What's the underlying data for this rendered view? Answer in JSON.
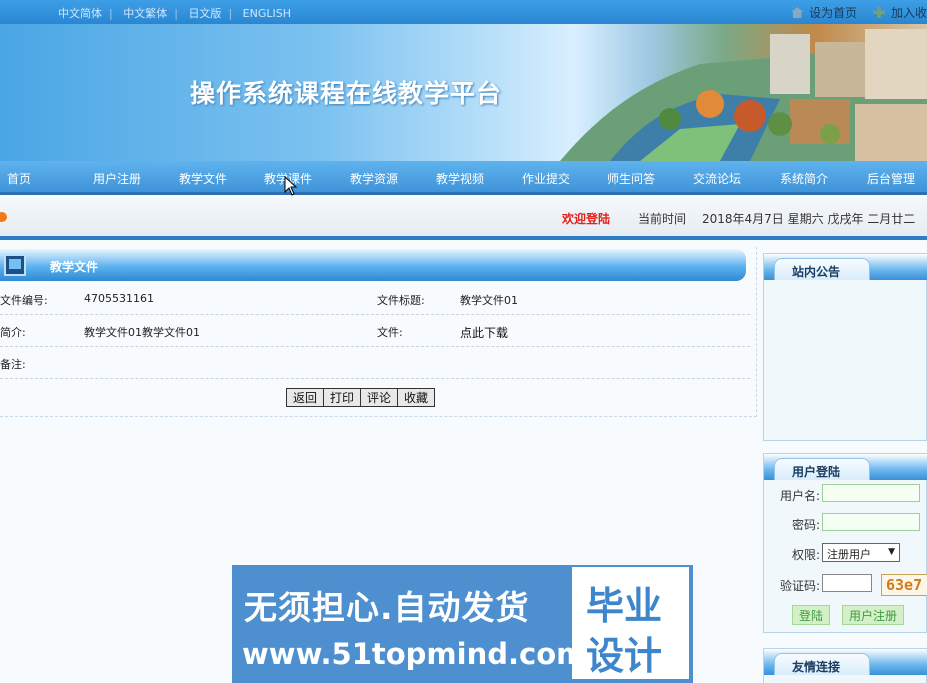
{
  "topbar": {
    "languages": [
      "中文简体",
      "中文繁体",
      "日文版",
      "ENGLISH"
    ],
    "set_home": "设为首页",
    "add_favorite": "加入收"
  },
  "banner": {
    "title": "操作系统课程在线教学平台"
  },
  "nav": {
    "items": [
      "首页",
      "用户注册",
      "教学文件",
      "教学课件",
      "教学资源",
      "教学视频",
      "作业提交",
      "师生问答",
      "交流论坛",
      "系统简介",
      "后台管理"
    ]
  },
  "strip": {
    "welcome": "欢迎登陆",
    "time_label": "当前时间",
    "time_value": "2018年4月7日 星期六 戊戌年 二月廿二"
  },
  "panel": {
    "title": "教学文件",
    "file_no_label": "文件编号:",
    "file_no_value": "4705531161",
    "file_title_label": "文件标题:",
    "file_title_value": "教学文件01",
    "intro_label": "简介:",
    "intro_value": "教学文件01教学文件01",
    "file_label": "文件:",
    "file_value": "点此下载",
    "remark_label": "备注:",
    "buttons": {
      "back": "返回",
      "print": "打印",
      "comment": "评论",
      "favorite": "收藏"
    }
  },
  "sidebar": {
    "notice_title": "站内公告",
    "login_title": "用户登陆",
    "username_label": "用户名:",
    "password_label": "密码:",
    "role_label": "权限:",
    "role_value": "注册用户",
    "captcha_label": "验证码:",
    "captcha_value": "63e7",
    "login_button": "登陆",
    "register_button": "用户注册",
    "links_title": "友情连接"
  },
  "ad": {
    "line1": "无须担心.自动发货",
    "line2": "www.51topmind.com",
    "box_line1": "毕业",
    "box_line2": "设计"
  },
  "colors": {
    "accent": "#2f7cc7",
    "welcome": "#e0221c",
    "nav": "#4fa5e6"
  }
}
